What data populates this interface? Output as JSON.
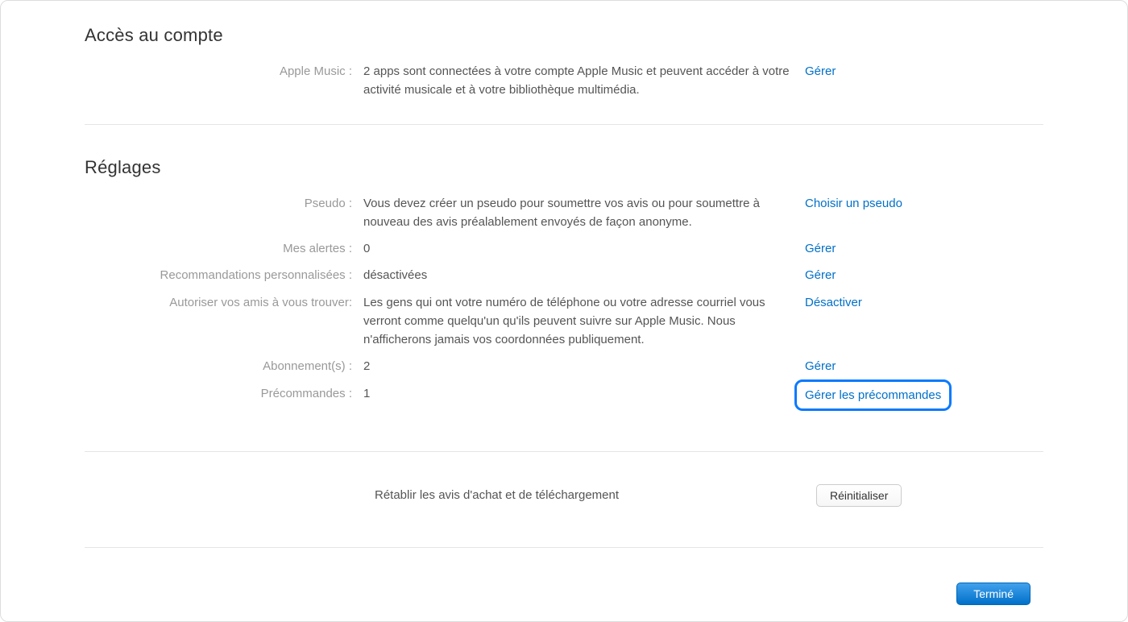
{
  "accountAccess": {
    "title": "Accès au compte",
    "appleMusic": {
      "label": "Apple Music :",
      "value": "2 apps sont connectées à votre compte Apple Music et peuvent accéder à votre activité musicale et à votre bibliothèque multimédia.",
      "action": "Gérer"
    }
  },
  "settings": {
    "title": "Réglages",
    "pseudo": {
      "label": "Pseudo :",
      "value": "Vous devez créer un pseudo pour soumettre vos avis ou pour soumettre à nouveau des avis préalablement envoyés de façon anonyme.",
      "action": "Choisir un pseudo"
    },
    "alerts": {
      "label": "Mes alertes :",
      "value": "0",
      "action": "Gérer"
    },
    "recommendations": {
      "label": "Recommandations personnalisées :",
      "value": "désactivées",
      "action": "Gérer"
    },
    "friends": {
      "label": "Autoriser vos amis à vous trouver:",
      "value": "Les gens qui ont votre numéro de téléphone ou votre adresse courriel vous verront comme quelqu'un qu'ils peuvent suivre sur Apple Music. Nous n'afficherons jamais vos coordonnées publiquement.",
      "action": "Désactiver"
    },
    "subscriptions": {
      "label": "Abonnement(s) :",
      "value": "2",
      "action": "Gérer"
    },
    "preorders": {
      "label": "Précommandes :",
      "value": "1",
      "action": "Gérer les précommandes"
    }
  },
  "reset": {
    "text": "Rétablir les avis d'achat et de téléchargement",
    "button": "Réinitialiser"
  },
  "footer": {
    "done": "Terminé"
  }
}
